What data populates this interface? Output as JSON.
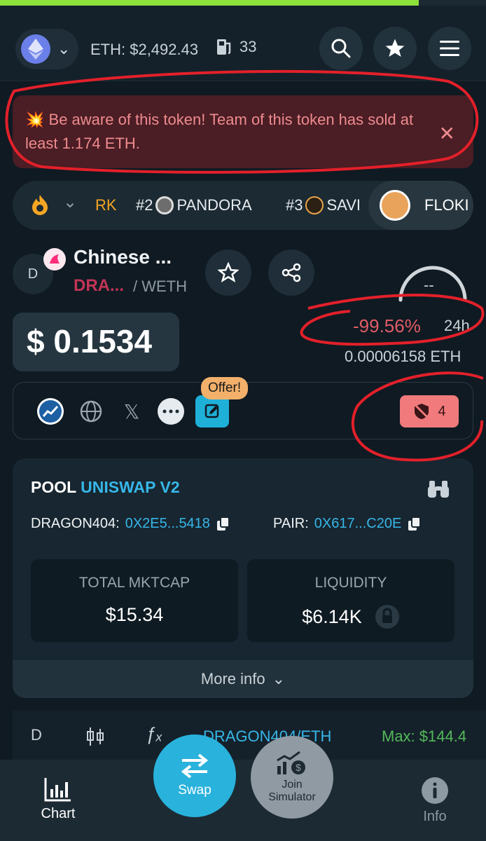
{
  "header": {
    "eth_price": "ETH: $2,492.43",
    "gas": "33"
  },
  "alert": {
    "emoji": "💥",
    "message": "Be aware of this token! Team of this token has sold at least 1.174 ETH."
  },
  "trending": [
    {
      "rank": "",
      "name": "RK"
    },
    {
      "rank": "#2",
      "name": "PANDORA"
    },
    {
      "rank": "#3",
      "name": "SAVI"
    },
    {
      "rank": "",
      "name": "FLOKI"
    }
  ],
  "token": {
    "avatar_letter": "D",
    "name": "Chinese ...",
    "symbol": "DRA...",
    "pair": "/ WETH",
    "gauge_value": "--",
    "price": "$ 0.1534",
    "change": "-99.56%",
    "change_period": "24h",
    "eth_value": "0.00006158 ETH",
    "offer_label": "Offer!",
    "audit_count": "4"
  },
  "pool": {
    "label": "POOL",
    "dex": "UNISWAP V2",
    "token_label": "DRAGON404:",
    "token_addr": "0X2E5...5418",
    "pair_label": "PAIR:",
    "pair_addr": "0X617...C20E",
    "mktcap_label": "TOTAL MKTCAP",
    "mktcap_value": "$15.34",
    "liquidity_label": "LIQUIDITY",
    "liquidity_value": "$6.14K",
    "more_info": "More info"
  },
  "chart_bar": {
    "interval": "D",
    "pair": "DRAGON404/ETH",
    "max": "Max: $144.4"
  },
  "bottom_nav": {
    "chart": "Chart",
    "swap": "Swap",
    "simulator": "Join Simulator",
    "info": "Info"
  },
  "colors": {
    "accent": "#37b6e8",
    "negative": "#e25b66",
    "alert_bg": "#4b1d24",
    "annotation": "#e3202a"
  }
}
